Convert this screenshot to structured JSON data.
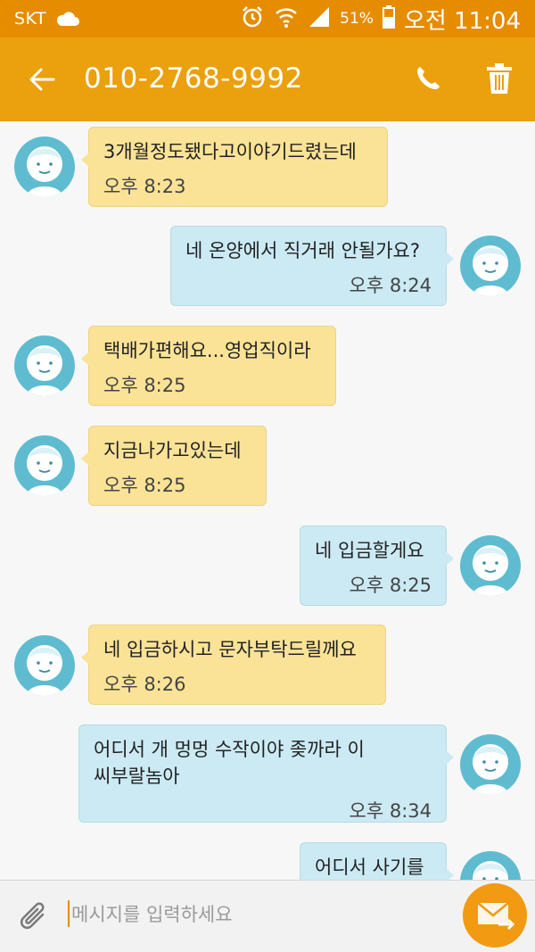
{
  "status_bar": {
    "carrier": "SKT",
    "battery_percent": "51%",
    "time": "오전 11:04"
  },
  "header": {
    "title": "010-2768-9992",
    "icons": [
      "back-arrow-icon",
      "phone-icon",
      "trash-icon"
    ]
  },
  "messages": [
    {
      "direction": "in",
      "text": "3개월정도됐다고이야기드렸는데",
      "time": "오후 8:23"
    },
    {
      "direction": "out",
      "text": "네 온양에서 직거래 안될가요?",
      "time": "오후 8:24"
    },
    {
      "direction": "in",
      "text": "택배가편해요...영업직이라",
      "time": "오후 8:25"
    },
    {
      "direction": "in",
      "text": "지금나가고있는데",
      "time": "오후 8:25"
    },
    {
      "direction": "out",
      "text": "네 입금할게요",
      "time": "오후 8:25"
    },
    {
      "direction": "in",
      "text": "네 입금하시고 문자부탁드릴께요",
      "time": "오후 8:26"
    },
    {
      "direction": "out",
      "text": "어디서 개 멍멍 수작이야 좆까라 이\n씨부랄놈아",
      "time": "오후 8:34"
    },
    {
      "direction": "out",
      "text": "어디서 사기를",
      "time": ""
    }
  ],
  "composer": {
    "placeholder": "메시지를 입력하세요",
    "value": ""
  },
  "colors": {
    "status_bar": "#e58c00",
    "app_bar": "#eba00e",
    "incoming_bubble": "#fae397",
    "outgoing_bubble": "#cbeaf4",
    "avatar": "#5fbcd0",
    "send_button": "#f29a12"
  }
}
